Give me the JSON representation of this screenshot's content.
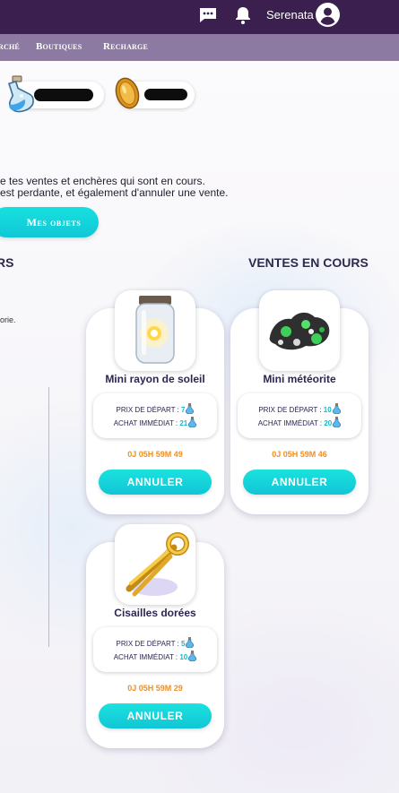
{
  "header": {
    "username": "Serenata",
    "icons": {
      "chat": "chat-bubble-icon",
      "notifications": "bell-icon",
      "account": "user-circle-icon"
    }
  },
  "nav": {
    "items": [
      {
        "label": "rché"
      },
      {
        "label": "Boutiques"
      },
      {
        "label": "Recharge"
      }
    ]
  },
  "intro": {
    "line1": "e tes ventes et enchères qui sont en cours.",
    "line2": "est perdante, et également d'annuler une vente.",
    "button": "Mes objets"
  },
  "left_section": {
    "title": "RS",
    "note": "orie."
  },
  "sales": {
    "title": "VENTES EN COURS",
    "start_price_label": "PRIX DE DÉPART : ",
    "instant_buy_label": "ACHAT IMMÉDIAT : ",
    "cancel_label": "ANNULER",
    "items": [
      {
        "name": "Mini rayon de soleil",
        "start_price": "7",
        "instant_price": "21",
        "timer": "0J 05H 59M 49"
      },
      {
        "name": "Mini météorite",
        "start_price": "10",
        "instant_price": "20",
        "timer": "0J 05H 59M 46"
      },
      {
        "name": "Cisailles dorées",
        "start_price": "5",
        "instant_price": "10",
        "timer": "0J 05H 59M 29"
      }
    ]
  },
  "colors": {
    "header_bg": "#3b1f4f",
    "nav_bg": "#8c7aa3",
    "accent_button": "#15d6db",
    "price_value": "#12b9c9",
    "timer": "#f08f22"
  }
}
